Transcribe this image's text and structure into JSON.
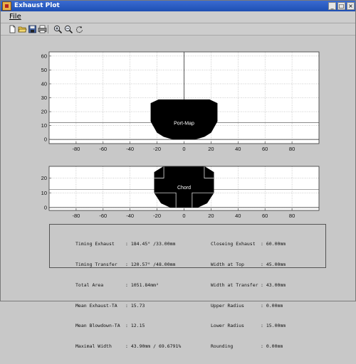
{
  "window": {
    "title": "Exhaust Plot"
  },
  "title_buttons": {
    "minimize": "_",
    "maximize": "□",
    "close": "×"
  },
  "menu": {
    "file": "File"
  },
  "toolbar_icons": [
    "new-file-icon",
    "open-folder-icon",
    "save-disk-icon",
    "print-icon",
    "zoom-in-icon",
    "zoom-out-icon",
    "rotate-icon"
  ],
  "chart_data": [
    {
      "type": "area",
      "xticks": [
        -80,
        -60,
        -40,
        -20,
        0,
        20,
        40,
        60,
        80
      ],
      "yticks": [
        0,
        10,
        20,
        30,
        40,
        50,
        60
      ],
      "xlim": [
        -100,
        100
      ],
      "ylim": [
        -3,
        63
      ],
      "grid": true,
      "annotations": [
        "Port-Map"
      ],
      "center_line_x": 0,
      "horizontal_line_y": 12.15,
      "shape": {
        "x": [
          -24.6,
          -24.6,
          -20,
          -15,
          -8,
          8,
          15,
          20,
          24.6,
          24.6,
          19,
          -19
        ],
        "y": [
          26,
          13,
          5,
          2,
          0,
          0,
          2,
          5,
          13,
          26,
          28.6,
          28.6
        ]
      }
    },
    {
      "type": "area",
      "xticks": [
        -80,
        -60,
        -40,
        -20,
        0,
        20,
        40,
        60,
        80
      ],
      "yticks": [
        0,
        10,
        20
      ],
      "xlim": [
        -100,
        100
      ],
      "ylim": [
        -2,
        28
      ],
      "grid": true,
      "annotations": [
        "Chord"
      ],
      "horizontal_line_y": 12.15,
      "shape": {
        "x": [
          -22,
          -22,
          -17,
          -10,
          10,
          17,
          22,
          22,
          15,
          -15
        ],
        "y": [
          24,
          10,
          3,
          0,
          0,
          3,
          10,
          24,
          28,
          28
        ]
      }
    }
  ],
  "info": {
    "left_labels": [
      "Timing Exhaust",
      "Timing Transfer",
      "Total Area",
      "Mean Exhaust-TA",
      "Mean Blowdown-TA",
      "Maximal Width"
    ],
    "left_values": [
      ": 184.45° /33.00mm",
      ": 120.57° /48.00mm",
      ": 1051.84mm²",
      ": 15.73",
      ": 12.15",
      ": 43.90mm / 69.6791%"
    ],
    "right_labels": [
      "Closeing Exhaust",
      "Width at Top",
      "Width at Transfer",
      "Upper Radius",
      "Lower Radius",
      "Rounding"
    ],
    "right_values": [
      ": 60.00mm",
      ": 45.00mm",
      ": 43.00mm",
      ": 0.00mm",
      ": 15.00mm",
      ": 0.00mm"
    ]
  }
}
